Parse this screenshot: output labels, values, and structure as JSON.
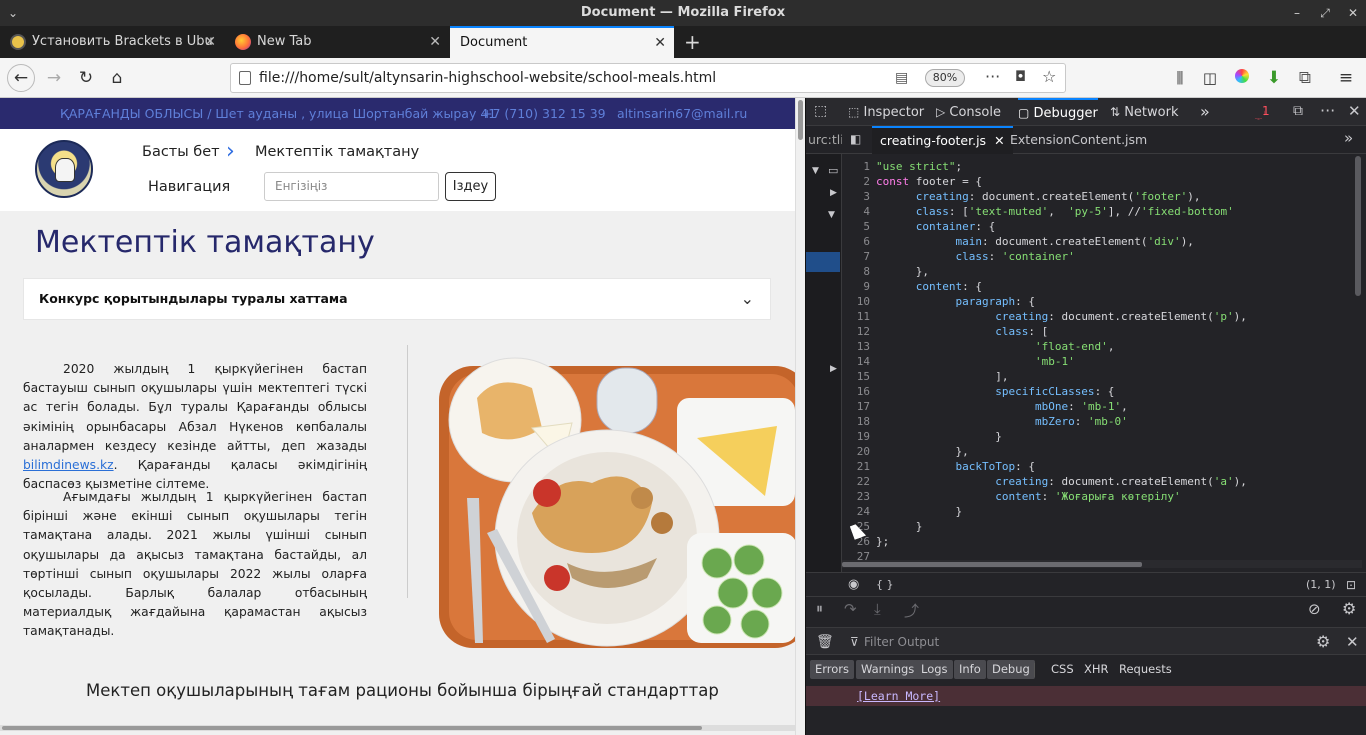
{
  "window": {
    "title": "Document — Mozilla Firefox",
    "controls": [
      "⌄",
      "–",
      "⤢",
      "✕"
    ]
  },
  "tabs": [
    {
      "label": "Установить Brackets в Ubu",
      "close": "✕"
    },
    {
      "label": "New Tab",
      "close": "✕"
    },
    {
      "label": "Document",
      "close": "✕"
    }
  ],
  "new_tab_label": "+",
  "navbar": {
    "url": "file:///home/sult/altynsarin-highschool-website/school-meals.html",
    "zoom": "80%"
  },
  "page": {
    "top_strip": {
      "address": "ҚАРАҒАНДЫ ОБЛЫСЫ / Шет ауданы , улица Шортанбай жырау 41",
      "phone": "+7 (710) 312 15 39",
      "email": "altinsarin67@mail.ru"
    },
    "header": {
      "breadcrumb_home": "Басты бет",
      "breadcrumb_sep": "›",
      "breadcrumb_current": "Мектептік тамақтану",
      "nav_label": "Навигация",
      "search_placeholder": "Енгізіңіз",
      "search_button": "Іздеу"
    },
    "title": "Мектептік тамақтану",
    "accordion": {
      "label": "Конкурс қорытындылары туралы хаттама",
      "chevron": "⌄"
    },
    "para1_before": "2020 жылдың 1 қыркүйегінен бастап бастауыш сынып оқушылары үшін мектептегі түскі ас тегін болады. Бұл туралы Қарағанды облысы әкімінің орынбасары Абзал Нүкенов көпбалалы аналармен кездесу кезінде айтты, деп жазады ",
    "para1_link": "bilimdinews.kz",
    "para1_after": ". Қарағанды қаласы әкімдігінің баспасөз қызметіне сілтеме.",
    "para2": "Ағымдағы жылдың 1 қыркүйегінен бастап бірінші және екінші сынып оқушылары тегін тамақтана алады. 2021 жылы үшінші сынып оқушылары да ақысыз тамақтана бастайды, ал төртінші сынып оқушылары 2022 жылы оларға қосылады. Барлық балалар отбасының материалдық жағдайына қарамастан ақысыз тамақтанады.",
    "section_title": "Мектеп оқушыларының тағам рационы бойынша бірыңғай стандарттар"
  },
  "devtools": {
    "tabs": {
      "inspector": "Inspector",
      "console": "Console",
      "debugger": "Debugger",
      "network": "Network",
      "more": "»",
      "error_count": "1"
    },
    "file_tabs": {
      "sources": "urc:tli",
      "active": "creating-footer.js",
      "other": "ExtensionContent.jsm"
    },
    "code_lines": [
      "\"use strict\";",
      "const footer = {",
      "      creating: document.createElement('footer'),",
      "      class: ['text-muted',  'py-5'], //'fixed-bottom'",
      "      container: {",
      "            main: document.createElement('div'),",
      "            class: 'container'",
      "      },",
      "      content: {",
      "            paragraph: {",
      "                  creating: document.createElement('p'),",
      "                  class: [",
      "                        'float-end',",
      "                        'mb-1'",
      "                  ],",
      "                  specificCLasses: {",
      "                        mbOne: 'mb-1',",
      "                        mbZero: 'mb-0'",
      "                  }",
      "            },",
      "            backToTop: {",
      "                  creating: document.createElement('a'),",
      "                  content: 'Жоғарыға көтерілу'",
      "            }",
      "      }",
      "};",
      "",
      ""
    ],
    "status": {
      "braces": "{ }",
      "position": "(1, 1)"
    },
    "console": {
      "filter_placeholder": "Filter Output",
      "filters": [
        "Errors",
        "Warnings",
        "Logs",
        "Info",
        "Debug",
        "CSS",
        "XHR",
        "Requests"
      ],
      "message_link": "[Learn More]"
    }
  }
}
